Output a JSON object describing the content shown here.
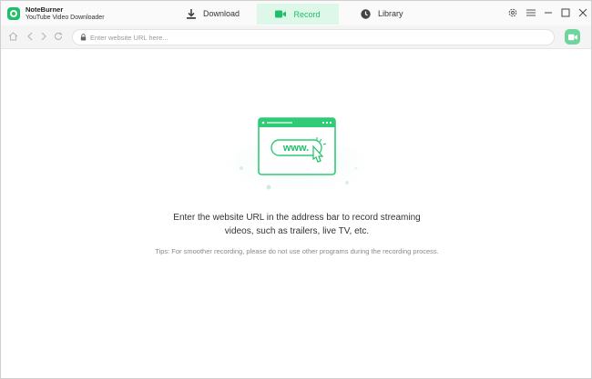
{
  "app": {
    "name": "NoteBurner",
    "subtitle": "YouTube Video Downloader",
    "brand_color": "#1fbf6a"
  },
  "tabs": [
    {
      "label": "Download",
      "icon": "download-icon",
      "active": false
    },
    {
      "label": "Record",
      "icon": "video-camera-icon",
      "active": true
    },
    {
      "label": "Library",
      "icon": "clock-icon",
      "active": false
    }
  ],
  "window_controls": [
    "settings-icon",
    "menu-icon",
    "minimize-icon",
    "maximize-icon",
    "close-icon"
  ],
  "navbar": {
    "url_value": "",
    "url_placeholder": "Enter website URL here...",
    "buttons": [
      "home-icon",
      "back-icon",
      "forward-icon",
      "reload-icon"
    ],
    "record_button_icon": "video-camera-icon"
  },
  "illustration": {
    "www_text": "www."
  },
  "main": {
    "message_line1": "Enter the website URL in the address bar to record streaming",
    "message_line2": "videos, such as trailers, live TV, etc.",
    "tips": "Tips: For smoother recording, please do not use other programs during the recording process."
  }
}
